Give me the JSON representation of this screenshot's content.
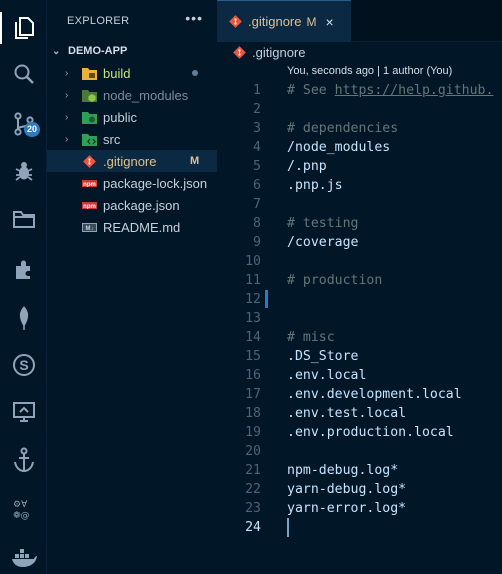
{
  "colors": {
    "accent": "#2f7bbf",
    "modified": "#e2c08d",
    "comment": "#637777",
    "text": "#c5e4fd",
    "background": "#011627"
  },
  "activity_bar": {
    "items": [
      {
        "icon": "files-icon"
      },
      {
        "icon": "search-icon"
      },
      {
        "icon": "source-control-icon",
        "badge": "20"
      },
      {
        "icon": "run-debug-icon"
      },
      {
        "icon": "folder-icon"
      },
      {
        "icon": "extensions-icon"
      },
      {
        "icon": "mongodb-leaf-icon"
      },
      {
        "icon": "s-circle-icon"
      },
      {
        "icon": "remote-explorer-icon"
      },
      {
        "icon": "anchor-icon"
      },
      {
        "icon": "symbols-icon"
      },
      {
        "icon": "docker-icon"
      }
    ]
  },
  "sidebar": {
    "title": "EXPLORER",
    "more": "•••",
    "section": "DEMO-APP",
    "items": [
      {
        "label": "build",
        "type": "folder",
        "icon": "build-folder-icon",
        "status": "dot"
      },
      {
        "label": "node_modules",
        "type": "folder",
        "icon": "node-folder-icon"
      },
      {
        "label": "public",
        "type": "folder",
        "icon": "public-folder-icon"
      },
      {
        "label": "src",
        "type": "folder",
        "icon": "src-folder-icon"
      },
      {
        "label": ".gitignore",
        "type": "file",
        "icon": "git-file-icon",
        "status": "M",
        "selected": true
      },
      {
        "label": "package-lock.json",
        "type": "file",
        "icon": "npm-file-icon"
      },
      {
        "label": "package.json",
        "type": "file",
        "icon": "npm-file-icon"
      },
      {
        "label": "README.md",
        "type": "file",
        "icon": "markdown-file-icon"
      }
    ]
  },
  "tab": {
    "name": ".gitignore",
    "status": "M",
    "close": "×"
  },
  "breadcrumb": {
    "file": ".gitignore"
  },
  "editor": {
    "blame": "You, seconds ago | 1 author (You)",
    "current_line": 24,
    "changed_line": 12,
    "lines": [
      {
        "n": "1",
        "text": "# See ",
        "link": "https://help.github.",
        "kind": "comment"
      },
      {
        "n": "2",
        "text": "",
        "kind": "text"
      },
      {
        "n": "3",
        "text": "# dependencies",
        "kind": "comment"
      },
      {
        "n": "4",
        "text": "/node_modules",
        "kind": "text"
      },
      {
        "n": "5",
        "text": "/.pnp",
        "kind": "text"
      },
      {
        "n": "6",
        "text": ".pnp.js",
        "kind": "text"
      },
      {
        "n": "7",
        "text": "",
        "kind": "text"
      },
      {
        "n": "8",
        "text": "# testing",
        "kind": "comment"
      },
      {
        "n": "9",
        "text": "/coverage",
        "kind": "text"
      },
      {
        "n": "10",
        "text": "",
        "kind": "text"
      },
      {
        "n": "11",
        "text": "# production",
        "kind": "comment"
      },
      {
        "n": "12",
        "text": "",
        "kind": "text"
      },
      {
        "n": "13",
        "text": "",
        "kind": "text"
      },
      {
        "n": "14",
        "text": "# misc",
        "kind": "comment"
      },
      {
        "n": "15",
        "text": ".DS_Store",
        "kind": "text"
      },
      {
        "n": "16",
        "text": ".env.local",
        "kind": "text"
      },
      {
        "n": "17",
        "text": ".env.development.local",
        "kind": "text"
      },
      {
        "n": "18",
        "text": ".env.test.local",
        "kind": "text"
      },
      {
        "n": "19",
        "text": ".env.production.local",
        "kind": "text"
      },
      {
        "n": "20",
        "text": "",
        "kind": "text"
      },
      {
        "n": "21",
        "text": "npm-debug.log*",
        "kind": "text"
      },
      {
        "n": "22",
        "text": "yarn-debug.log*",
        "kind": "text"
      },
      {
        "n": "23",
        "text": "yarn-error.log*",
        "kind": "text"
      },
      {
        "n": "24",
        "text": "",
        "kind": "text"
      }
    ]
  }
}
